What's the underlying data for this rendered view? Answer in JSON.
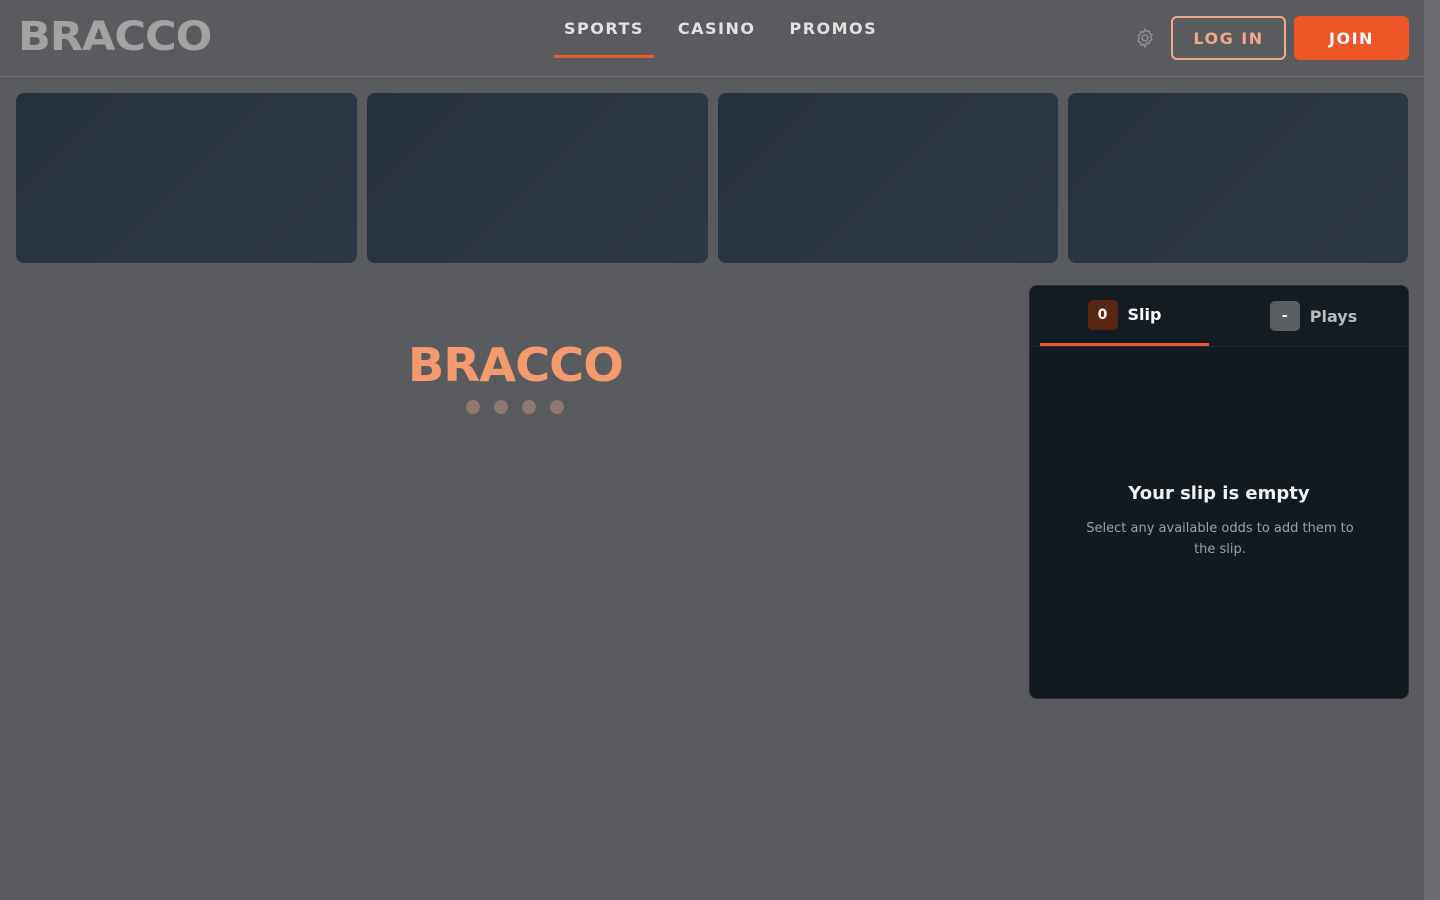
{
  "header": {
    "logo": "BRACCO",
    "nav": [
      "SPORTS",
      "CASINO",
      "PROMOS"
    ],
    "active_nav": "SPORTS",
    "settings_icon": "gear-icon",
    "login_label": "LOG IN",
    "join_label": "JOIN"
  },
  "colors": {
    "accent": "#ee5527",
    "background": "#595b5e",
    "panel": "#121a21"
  },
  "loader": {
    "logo": "BRACCO"
  },
  "slip": {
    "tabs": [
      {
        "badge": "0",
        "label": "Slip"
      },
      {
        "badge": "-",
        "label": "Plays"
      }
    ],
    "empty_title": "Your slip is empty",
    "empty_subtitle": "Select any available odds to add them to the slip."
  }
}
